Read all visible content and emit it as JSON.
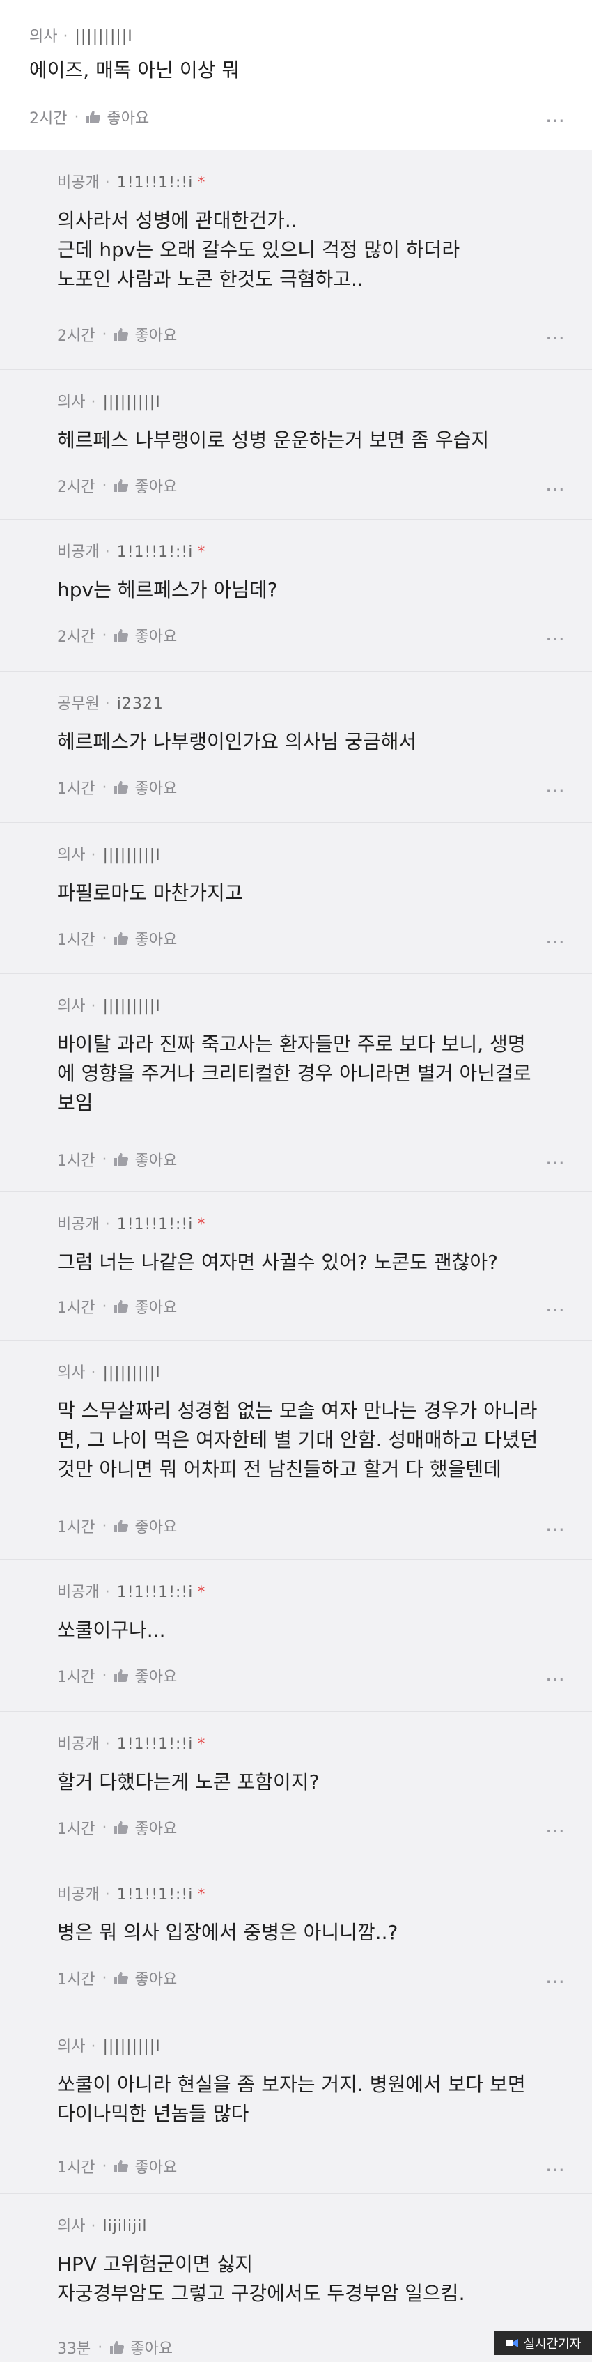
{
  "comments": [
    {
      "job": "의사",
      "nick": "|||||||||I",
      "dot": "",
      "lines": [
        "에이즈, 매독 아닌 이상 뭐"
      ],
      "time": "2시간",
      "like": "좋아요"
    },
    {
      "job": "비공개",
      "nick": "1!1!!1!:!i",
      "dot": "*",
      "lines": [
        "의사라서 성병에 관대한건가..",
        "근데 hpv는 오래 갈수도 있으니 걱정 많이 하더라",
        "노포인 사람과 노콘 한것도 극혐하고.."
      ],
      "time": "2시간",
      "like": "좋아요"
    },
    {
      "job": "의사",
      "nick": "|||||||||I",
      "dot": "",
      "lines": [
        "헤르페스 나부랭이로 성병 운운하는거 보면 좀 우습지"
      ],
      "time": "2시간",
      "like": "좋아요"
    },
    {
      "job": "비공개",
      "nick": "1!1!!1!:!i",
      "dot": "*",
      "lines": [
        "hpv는 헤르페스가 아님데?"
      ],
      "time": "2시간",
      "like": "좋아요"
    },
    {
      "job": "공무원",
      "nick": "i2321",
      "dot": "",
      "lines": [
        "헤르페스가 나부랭이인가요 의사님 궁금해서"
      ],
      "time": "1시간",
      "like": "좋아요"
    },
    {
      "job": "의사",
      "nick": "|||||||||I",
      "dot": "",
      "lines": [
        "파필로마도 마찬가지고"
      ],
      "time": "1시간",
      "like": "좋아요"
    },
    {
      "job": "의사",
      "nick": "|||||||||I",
      "dot": "",
      "lines": [
        "바이탈 과라 진짜 죽고사는 환자들만 주로 보다 보니, 생명",
        "에 영향을 주거나 크리티컬한 경우 아니라면 별거 아닌걸로",
        "보임"
      ],
      "time": "1시간",
      "like": "좋아요"
    },
    {
      "job": "비공개",
      "nick": "1!1!!1!:!i",
      "dot": "*",
      "lines": [
        "그럼 너는 나같은 여자면 사귈수 있어? 노콘도 괜찮아?"
      ],
      "time": "1시간",
      "like": "좋아요"
    },
    {
      "job": "의사",
      "nick": "|||||||||I",
      "dot": "",
      "lines": [
        "막 스무살짜리 성경험 없는 모솔 여자 만나는 경우가 아니라",
        "면, 그 나이 먹은 여자한테 별 기대 안함. 성매매하고 다녔던",
        "것만 아니면 뭐 어차피 전 남친들하고 할거 다 했을텐데"
      ],
      "time": "1시간",
      "like": "좋아요"
    },
    {
      "job": "비공개",
      "nick": "1!1!!1!:!i",
      "dot": "*",
      "lines": [
        "쏘쿨이구나..."
      ],
      "time": "1시간",
      "like": "좋아요"
    },
    {
      "job": "비공개",
      "nick": "1!1!!1!:!i",
      "dot": "*",
      "lines": [
        "할거 다했다는게 노콘 포함이지?"
      ],
      "time": "1시간",
      "like": "좋아요"
    },
    {
      "job": "비공개",
      "nick": "1!1!!1!:!i",
      "dot": "*",
      "lines": [
        "병은 뭐 의사 입장에서 중병은 아니니깜..?"
      ],
      "time": "1시간",
      "like": "좋아요"
    },
    {
      "job": "의사",
      "nick": "|||||||||I",
      "dot": "",
      "lines": [
        "쏘쿨이 아니라 현실을 좀 보자는 거지. 병원에서 보다 보면",
        "다이나믹한 년놈들 많다"
      ],
      "time": "1시간",
      "like": "좋아요"
    },
    {
      "job": "의사",
      "nick": "lijilijil",
      "dot": "",
      "lines": [
        "HPV 고위험군이면 싫지",
        "자궁경부암도 그렇고 구강에서도 두경부암 일으킴."
      ],
      "time": "33분",
      "like": "좋아요"
    }
  ],
  "watermark": "실시간기자",
  "colors": {
    "background": "#f2f2f4",
    "meta": "#8a8a8e",
    "accent_dot": "#e34b4b"
  }
}
